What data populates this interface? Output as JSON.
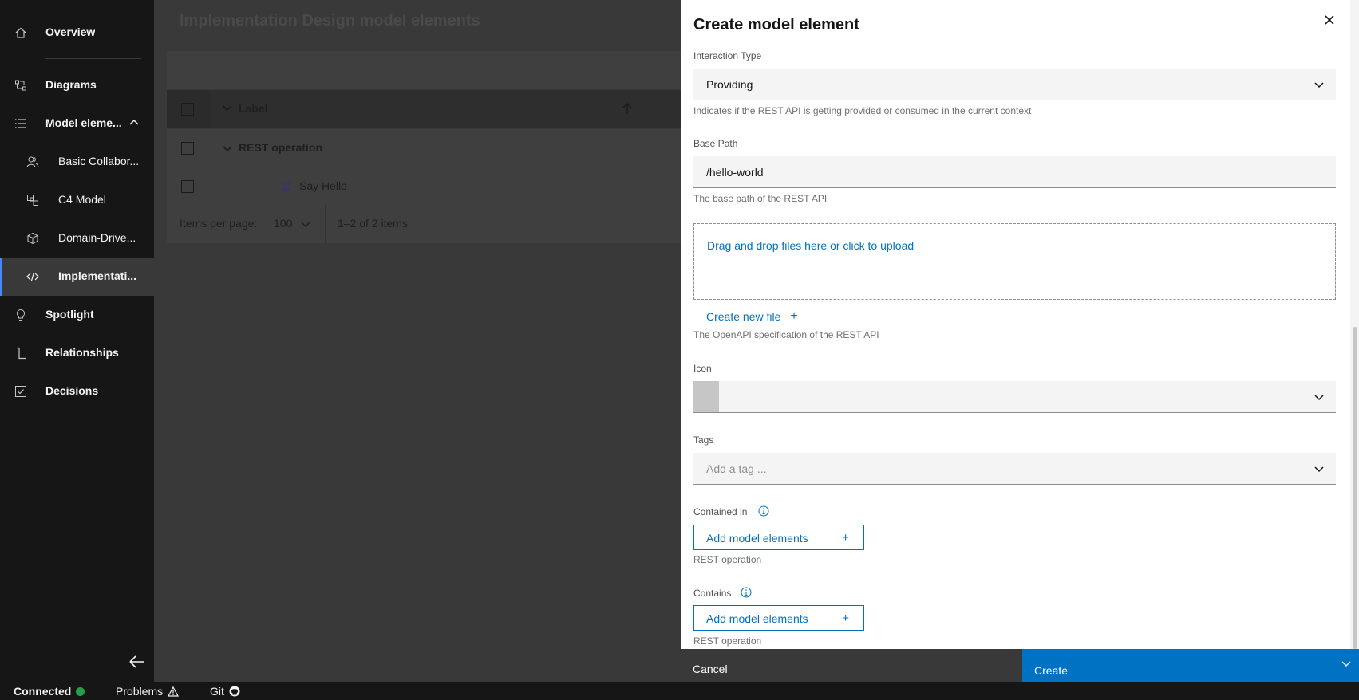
{
  "sidebar": {
    "items": [
      {
        "label": "Overview",
        "icon": "home-icon"
      },
      {
        "label": "Diagrams",
        "icon": "diagram-icon"
      },
      {
        "label": "Model eleme...",
        "icon": "list-icon"
      },
      {
        "label": "Basic Collabor...",
        "icon": "users-icon"
      },
      {
        "label": "C4 Model",
        "icon": "c4-icon"
      },
      {
        "label": "Domain-Drive...",
        "icon": "cube-icon"
      },
      {
        "label": "Implementati...",
        "icon": "code-icon"
      },
      {
        "label": "Spotlight",
        "icon": "lightbulb-icon"
      },
      {
        "label": "Relationships",
        "icon": "relationship-icon"
      },
      {
        "label": "Decisions",
        "icon": "checkbox-icon"
      }
    ]
  },
  "status": {
    "connected": "Connected",
    "problems": "Problems",
    "git": "Git",
    "connected_color": "#24a148"
  },
  "main": {
    "title": "Implementation Design model elements",
    "table": {
      "header": "Label",
      "group": "REST operation",
      "row": "Say Hello"
    },
    "pager": {
      "items_per_page_label": "Items per page:",
      "items_per_page_value": "100",
      "range": "1–2 of 2 items"
    }
  },
  "panel": {
    "title": "Create model element",
    "interaction_type": {
      "label": "Interaction Type",
      "value": "Providing",
      "helper": "Indicates if the REST API is getting provided or consumed in the current context"
    },
    "base_path": {
      "label": "Base Path",
      "value": "/hello-world",
      "helper": "The base path of the REST API"
    },
    "upload": {
      "dropzone_text": "Drag and drop files here or click to upload",
      "create_new_file": "Create new file",
      "helper": "The OpenAPI specification of the REST API"
    },
    "icon_field": {
      "label": "Icon"
    },
    "tags": {
      "label": "Tags",
      "placeholder": "Add a tag ..."
    },
    "contained_in": {
      "label": "Contained in",
      "button": "Add model elements",
      "helper": "REST operation"
    },
    "contains": {
      "label": "Contains",
      "button": "Add model elements",
      "helper": "REST operation"
    },
    "footer": {
      "cancel": "Cancel",
      "create": "Create"
    }
  },
  "colors": {
    "primary": "#0072c3",
    "sidebar_bg": "#161616",
    "active_indicator": "#4589ff"
  }
}
